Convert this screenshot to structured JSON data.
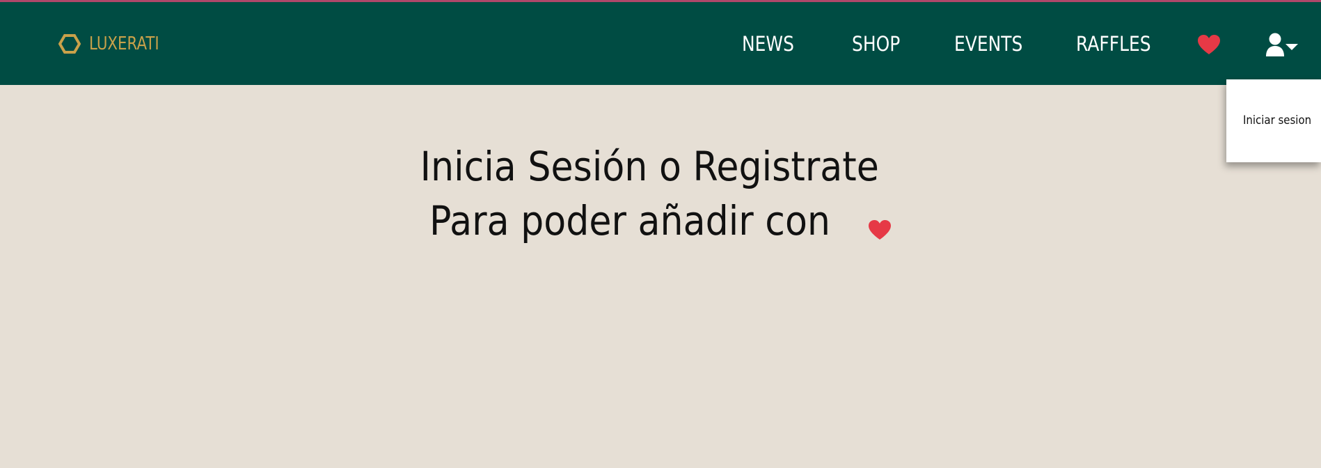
{
  "header": {
    "brand_name": "LUXERATI",
    "brand_logo_icon": "hexagon-logo-icon",
    "nav": {
      "news": "NEWS",
      "shop": "SHOP",
      "events": "EVENTS",
      "raffles": "RAFFLES"
    },
    "favorites_icon": "heart-icon",
    "user_icon": "user-dropdown-icon"
  },
  "user_menu": {
    "login": "Iniciar sesion"
  },
  "main": {
    "title": "Inicia Sesión o Registrate",
    "subtitle": "Para poder añadir con"
  },
  "colors": {
    "navbar": "#004c43",
    "brand": "#c9a14a",
    "background": "#e6dfd5",
    "heart": "#e63946",
    "accent_line": "#b0476a"
  }
}
